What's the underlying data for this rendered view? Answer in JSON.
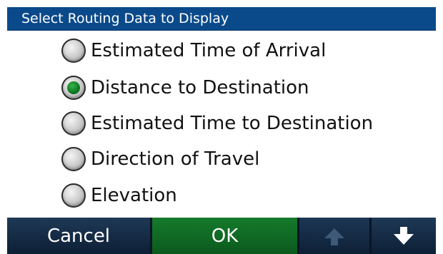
{
  "header": {
    "title": "Select Routing Data to Display",
    "color": "#0b4a8a"
  },
  "options": [
    {
      "label": "Estimated Time of Arrival",
      "selected": false
    },
    {
      "label": "Distance to Destination",
      "selected": true
    },
    {
      "label": "Estimated Time to Destination",
      "selected": false
    },
    {
      "label": "Direction of Travel",
      "selected": false
    },
    {
      "label": "Elevation",
      "selected": false
    }
  ],
  "buttons": {
    "cancel_label": "Cancel",
    "ok_label": "OK",
    "up_icon": "arrow-up-icon",
    "down_icon": "arrow-down-icon",
    "ok_color": "#157a2b",
    "nav_color": "#1e3956"
  },
  "selected_color": "#0b7a22"
}
